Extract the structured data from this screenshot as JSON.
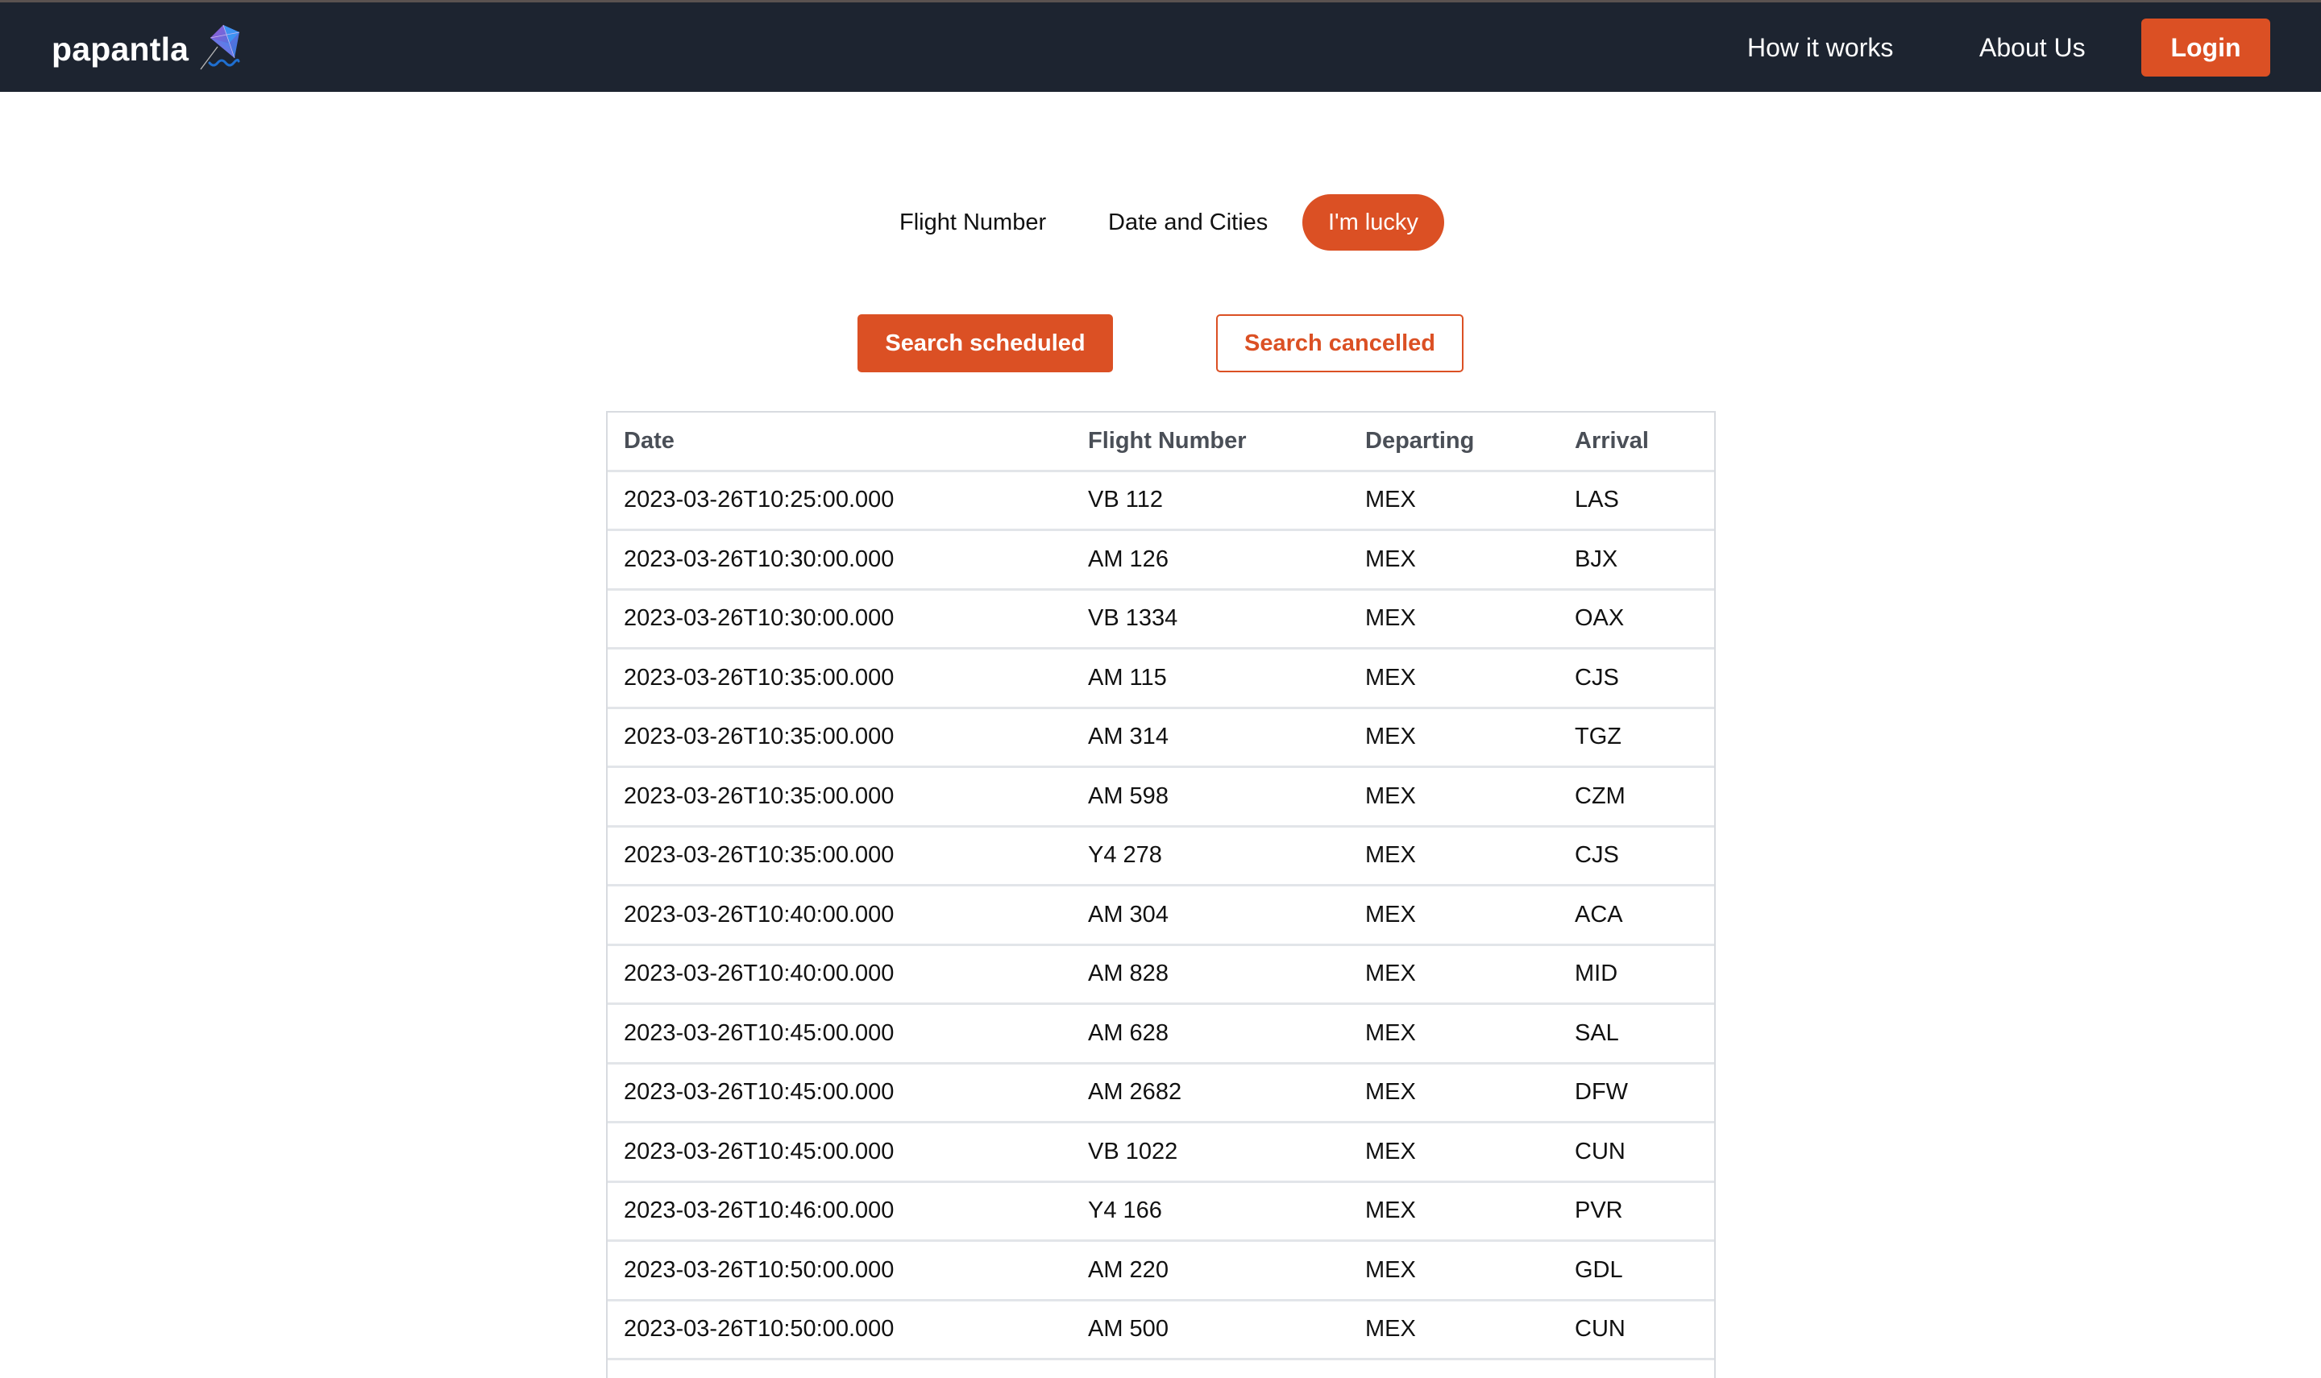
{
  "brand": {
    "name": "papantla",
    "logo_icon": "kite-icon",
    "accent_color": "#db5024",
    "nav_bg_color": "#1d2430"
  },
  "nav": {
    "links": [
      {
        "label": "How it works"
      },
      {
        "label": "About Us"
      }
    ],
    "login_label": "Login"
  },
  "search_tabs": {
    "items": [
      {
        "label": "Flight Number",
        "active": false
      },
      {
        "label": "Date and Cities",
        "active": false
      },
      {
        "label": "I'm lucky",
        "active": true
      }
    ]
  },
  "actions": {
    "search_scheduled_label": "Search scheduled",
    "search_cancelled_label": "Search cancelled"
  },
  "table": {
    "columns": [
      "Date",
      "Flight Number",
      "Departing",
      "Arrival"
    ],
    "rows": [
      [
        "2023-03-26T10:25:00.000",
        "VB 112",
        "MEX",
        "LAS"
      ],
      [
        "2023-03-26T10:30:00.000",
        "AM 126",
        "MEX",
        "BJX"
      ],
      [
        "2023-03-26T10:30:00.000",
        "VB 1334",
        "MEX",
        "OAX"
      ],
      [
        "2023-03-26T10:35:00.000",
        "AM 115",
        "MEX",
        "CJS"
      ],
      [
        "2023-03-26T10:35:00.000",
        "AM 314",
        "MEX",
        "TGZ"
      ],
      [
        "2023-03-26T10:35:00.000",
        "AM 598",
        "MEX",
        "CZM"
      ],
      [
        "2023-03-26T10:35:00.000",
        "Y4 278",
        "MEX",
        "CJS"
      ],
      [
        "2023-03-26T10:40:00.000",
        "AM 304",
        "MEX",
        "ACA"
      ],
      [
        "2023-03-26T10:40:00.000",
        "AM 828",
        "MEX",
        "MID"
      ],
      [
        "2023-03-26T10:45:00.000",
        "AM 628",
        "MEX",
        "SAL"
      ],
      [
        "2023-03-26T10:45:00.000",
        "AM 2682",
        "MEX",
        "DFW"
      ],
      [
        "2023-03-26T10:45:00.000",
        "VB 1022",
        "MEX",
        "CUN"
      ],
      [
        "2023-03-26T10:46:00.000",
        "Y4 166",
        "MEX",
        "PVR"
      ],
      [
        "2023-03-26T10:50:00.000",
        "AM 220",
        "MEX",
        "GDL"
      ],
      [
        "2023-03-26T10:50:00.000",
        "AM 500",
        "MEX",
        "CUN"
      ]
    ]
  }
}
